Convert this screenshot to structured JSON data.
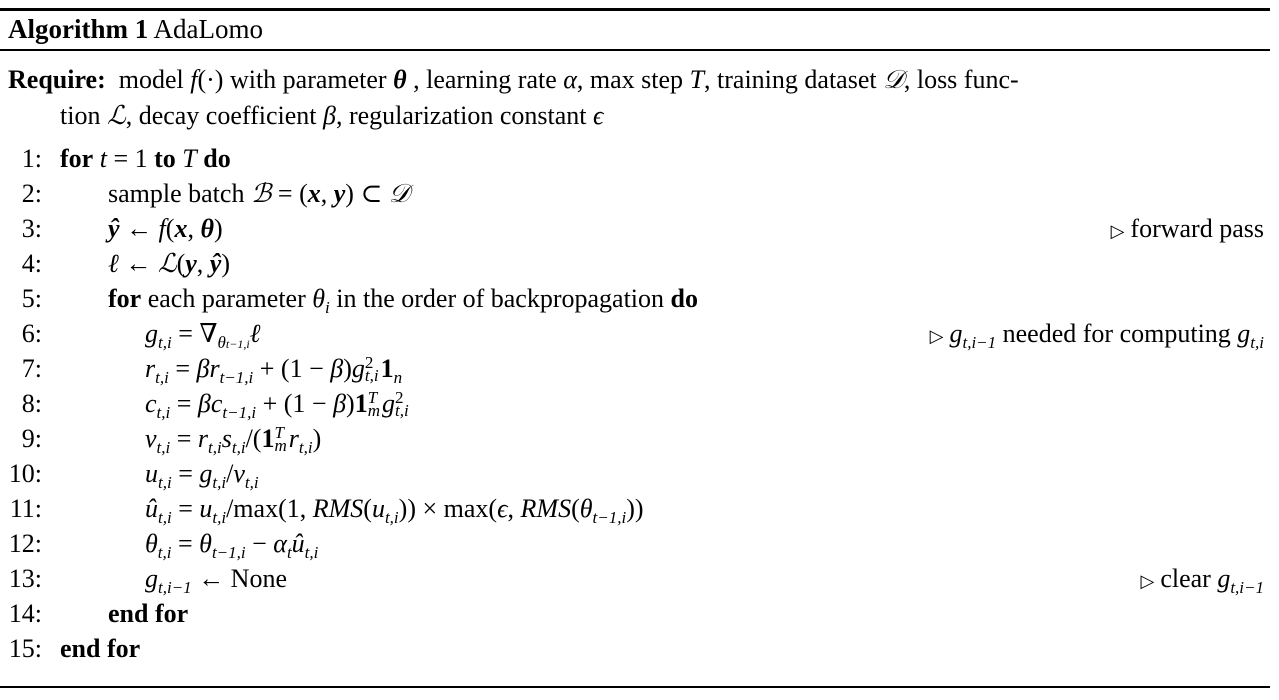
{
  "algorithm": {
    "label": "Algorithm 1",
    "name": "AdaLomo"
  },
  "require": {
    "keyword": "Require:",
    "line1": "model f(·) with parameter θ , learning rate α, max step T, training dataset 𝒟, loss func-",
    "line2": "tion ℒ, decay coefficient β, regularization constant ϵ"
  },
  "lines": [
    {
      "num": "1:",
      "indent": 0,
      "text": "for t = 1 to T do",
      "comment": ""
    },
    {
      "num": "2:",
      "indent": 1,
      "text": "sample batch ℬ = (x, y) ⊂ 𝒟",
      "comment": ""
    },
    {
      "num": "3:",
      "indent": 1,
      "text": "ŷ ← f(x, θ)",
      "comment": "forward pass"
    },
    {
      "num": "4:",
      "indent": 1,
      "text": "ℓ ← ℒ(y, ŷ)",
      "comment": ""
    },
    {
      "num": "5:",
      "indent": 1,
      "text": "for each parameter θ_i in the order of backpropagation do",
      "comment": ""
    },
    {
      "num": "6:",
      "indent": 2,
      "text": "g_{t,i} = ∇_{θ_{t−1,i}} ℓ",
      "comment": "g_{t,i−1} needed for computing g_{t,i}"
    },
    {
      "num": "7:",
      "indent": 2,
      "text": "r_{t,i} = β r_{t−1,i} + (1 − β) g²_{t,i} 1_n",
      "comment": ""
    },
    {
      "num": "8:",
      "indent": 2,
      "text": "c_{t,i} = β c_{t−1,i} + (1 − β) 1ᵀ_m g²_{t,i}",
      "comment": ""
    },
    {
      "num": "9:",
      "indent": 2,
      "text": "v_{t,i} = r_{t,i} s_{t,i} / (1ᵀ_m r_{t,i})",
      "comment": ""
    },
    {
      "num": "10:",
      "indent": 2,
      "text": "u_{t,i} = g_{t,i} / v_{t,i}",
      "comment": ""
    },
    {
      "num": "11:",
      "indent": 2,
      "text": "û_{t,i} = u_{t,i} / max(1, RMS(u_{t,i})) × max(ϵ, RMS(θ_{t−1,i}))",
      "comment": ""
    },
    {
      "num": "12:",
      "indent": 2,
      "text": "θ_{t,i} = θ_{t−1,i} − α_t û_{t,i}",
      "comment": ""
    },
    {
      "num": "13:",
      "indent": 2,
      "text": "g_{t,i−1} ← None",
      "comment": "clear g_{t,i−1}"
    },
    {
      "num": "14:",
      "indent": 1,
      "text": "end for",
      "comment": ""
    },
    {
      "num": "15:",
      "indent": 0,
      "text": "end for",
      "comment": ""
    }
  ],
  "tokens": {
    "for": "for",
    "to": "to",
    "do": "do",
    "end_for": "end for",
    "each_param": "each parameter",
    "order": "in the order of backpropagation",
    "sample_batch": "sample batch",
    "none": "None",
    "forward_pass": "forward pass",
    "needed": "needed for computing",
    "clear": "clear",
    "comment_marker": "▷"
  }
}
